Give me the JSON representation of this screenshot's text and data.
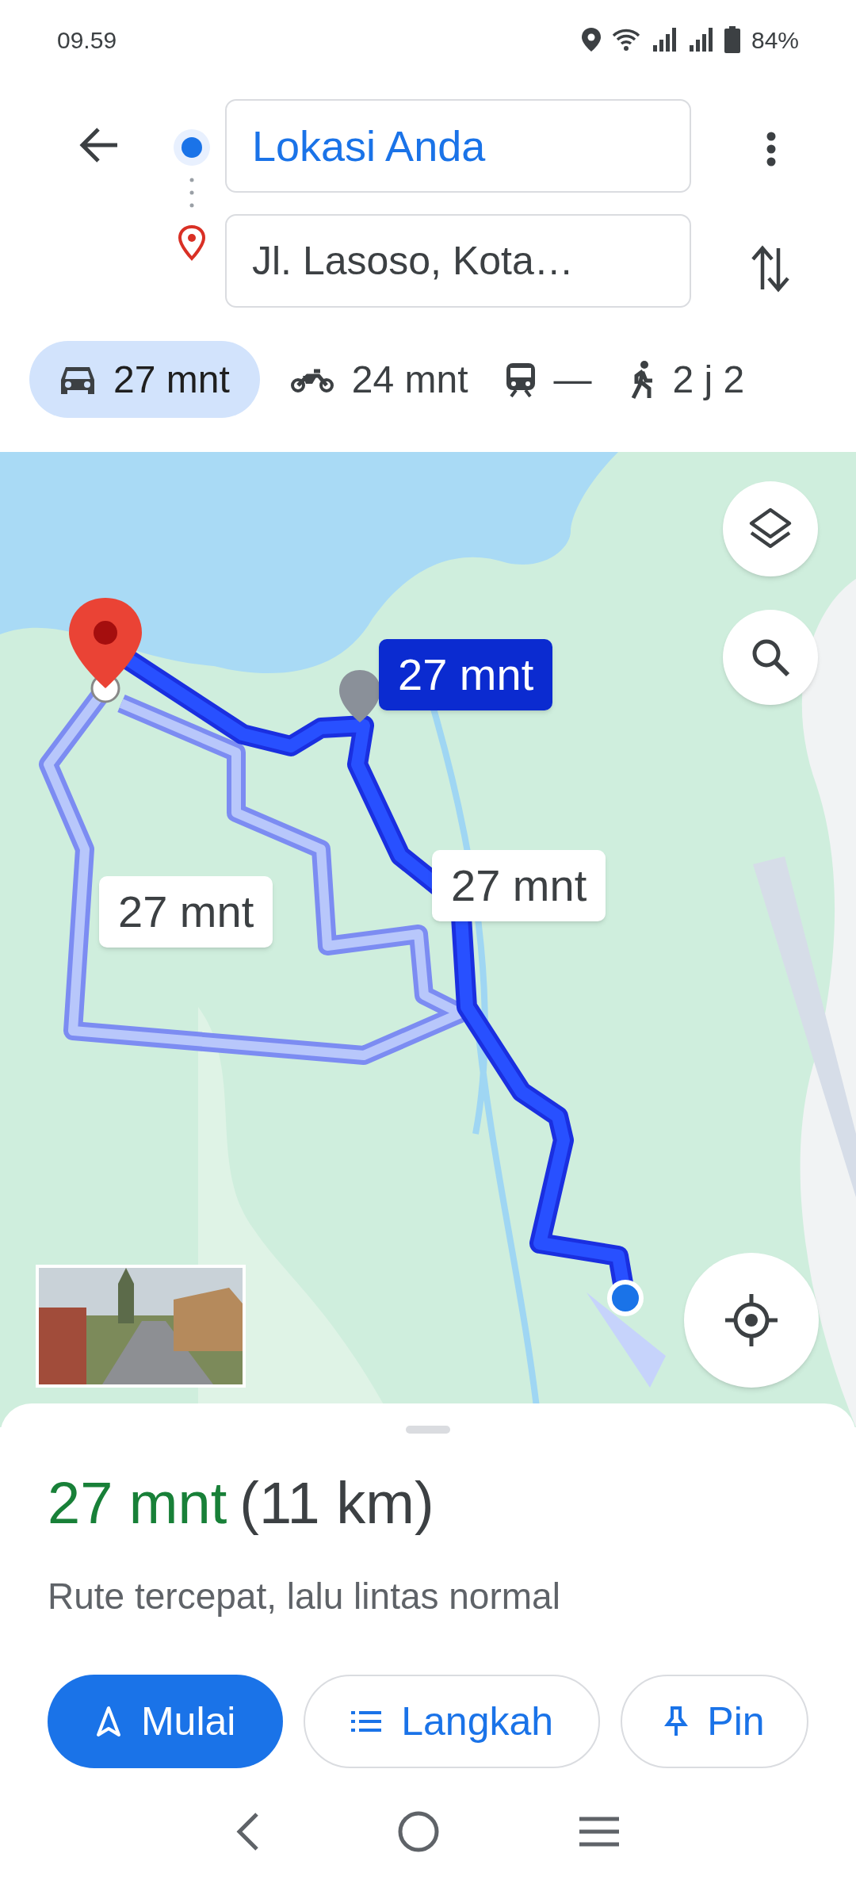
{
  "status_bar": {
    "time": "09.59",
    "battery": "84%"
  },
  "route": {
    "origin": "Lokasi Anda",
    "destination": "Jl. Lasoso, Kota…"
  },
  "modes": [
    {
      "kind": "car",
      "label": "27 mnt",
      "selected": true
    },
    {
      "kind": "motorcycle",
      "label": "24 mnt",
      "selected": false
    },
    {
      "kind": "transit",
      "label": "—",
      "selected": false
    },
    {
      "kind": "walk",
      "label": "2 j 2",
      "selected": false
    }
  ],
  "map": {
    "route_labels": [
      {
        "label": "27 mnt",
        "selected": true
      },
      {
        "label": "27 mnt",
        "selected": false
      },
      {
        "label": "27 mnt",
        "selected": false
      }
    ]
  },
  "summary": {
    "duration": "27 mnt",
    "distance": "(11 km)",
    "description": "Rute tercepat, lalu lintas normal"
  },
  "actions": [
    {
      "kind": "start",
      "label": "Mulai"
    },
    {
      "kind": "steps",
      "label": "Langkah"
    },
    {
      "kind": "pin",
      "label": "Pin"
    }
  ]
}
